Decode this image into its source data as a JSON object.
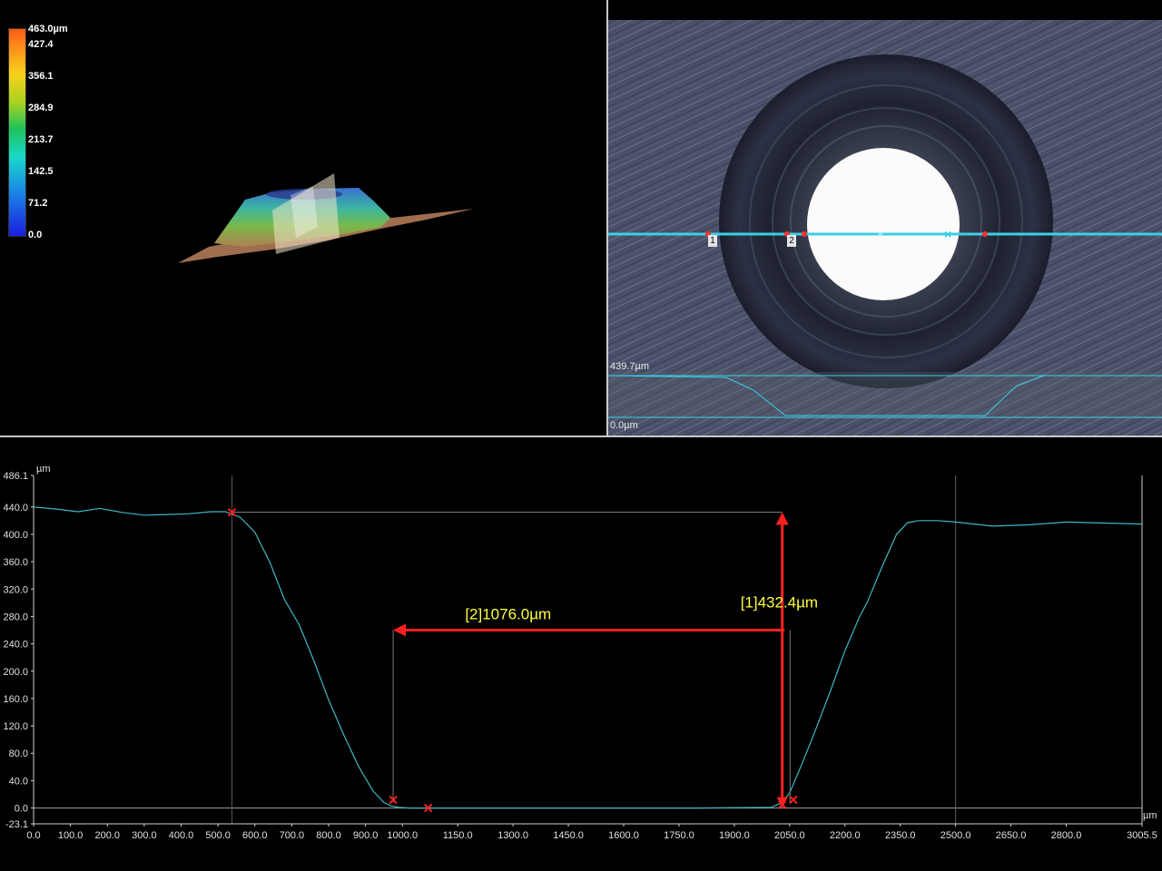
{
  "colorbar": {
    "labels": [
      "463.0µm",
      "427.4",
      "356.1",
      "284.9",
      "213.7",
      "142.5",
      "71.2",
      "0.0"
    ]
  },
  "image_view": {
    "scale_top": "439.7µm",
    "scale_bottom": "0.0µm",
    "markers": [
      "1",
      "2"
    ],
    "line_color": "#3ad0e6"
  },
  "chart_data": {
    "type": "line",
    "x_unit": "µm",
    "y_unit": "µm",
    "xlim": [
      0.0,
      3005.5
    ],
    "ylim": [
      -23.1,
      486.1
    ],
    "x_ticks": [
      0.0,
      100.0,
      200.0,
      300.0,
      400.0,
      500.0,
      600.0,
      700.0,
      800.0,
      900.0,
      1000.0,
      1150.0,
      1300.0,
      1450.0,
      1600.0,
      1750.0,
      1900.0,
      2050.0,
      2200.0,
      2350.0,
      2500.0,
      2650.0,
      2800.0,
      3005.5
    ],
    "x_tick_labels": [
      "0.0",
      "100.0",
      "200.0",
      "300.0",
      "400.0",
      "500.0",
      "600.0",
      "700.0",
      "800.0",
      "900.0",
      "1000.0",
      "1150.0",
      "1300.0",
      "1450.0",
      "1600.0",
      "1750.0",
      "1900.0",
      "2050.0",
      "2200.0",
      "2350.0",
      "2500.0",
      "2650.0",
      "2800.0",
      "3005.5"
    ],
    "y_ticks": [
      -23.1,
      0.0,
      40.0,
      80.0,
      120.0,
      160.0,
      200.0,
      240.0,
      280.0,
      320.0,
      360.0,
      400.0,
      440.0,
      486.1
    ],
    "y_tick_labels": [
      "-23.1",
      "0.0",
      "40.0",
      "80.0",
      "120.0",
      "160.0",
      "200.0",
      "240.0",
      "280.0",
      "320.0",
      "360.0",
      "400.0",
      "440.0",
      "486.1"
    ],
    "series": [
      {
        "color": "#3fb8c2",
        "x": [
          0,
          60,
          120,
          180,
          240,
          300,
          360,
          420,
          480,
          520,
          560,
          600,
          640,
          680,
          720,
          760,
          800,
          840,
          880,
          920,
          950,
          970,
          990,
          1020,
          1060,
          1200,
          1500,
          1800,
          2000,
          2030,
          2050,
          2080,
          2110,
          2160,
          2200,
          2240,
          2260,
          2300,
          2340,
          2370,
          2400,
          2450,
          2500,
          2600,
          2700,
          2800,
          3005.5
        ],
        "y": [
          440,
          437,
          433,
          438,
          432,
          428,
          429,
          430,
          433,
          433,
          425,
          403,
          360,
          305,
          268,
          215,
          158,
          108,
          62,
          25,
          8,
          3,
          1,
          0,
          0,
          0,
          0,
          0,
          1,
          8,
          22,
          60,
          100,
          170,
          230,
          280,
          300,
          352,
          400,
          417,
          420,
          420,
          418,
          412,
          414,
          418,
          415
        ]
      }
    ],
    "vertical_guides_x": [
      538,
      2500
    ],
    "markers_x": [
      [
        538,
        432
      ],
      [
        975,
        12
      ],
      [
        1070,
        0
      ],
      [
        2030,
        5
      ],
      [
        2060,
        12
      ]
    ],
    "measurements": [
      {
        "label": "[1]432.4µm",
        "color": "#ffff3c"
      },
      {
        "label": "[2]1076.0µm",
        "color": "#ffff3c"
      }
    ],
    "measure_1": {
      "x": 2030,
      "y_from": 0,
      "y_to": 432.4
    },
    "measure_2": {
      "x_from": 975,
      "x_to": 2051,
      "y": 260
    }
  }
}
